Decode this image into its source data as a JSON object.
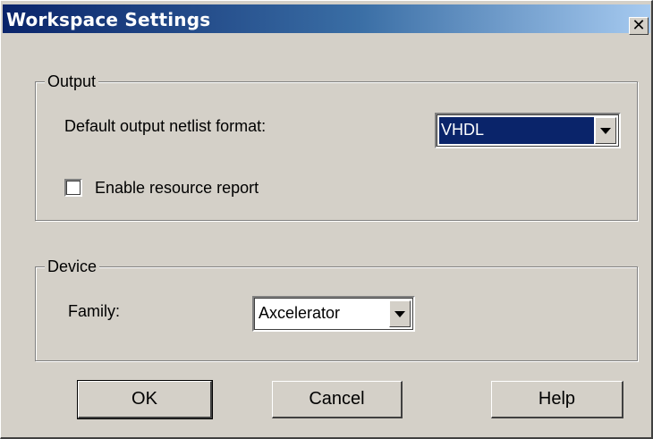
{
  "window": {
    "title": "Workspace Settings",
    "close_glyph": "✕"
  },
  "output_group": {
    "label": "Output",
    "netlist_format_label": "Default output netlist format:",
    "netlist_format_value": "VHDL",
    "resource_report_label": "Enable resource report",
    "resource_report_checked": false
  },
  "device_group": {
    "label": "Device",
    "family_label": "Family:",
    "family_value": "Axcelerator"
  },
  "buttons": {
    "ok": "OK",
    "cancel": "Cancel",
    "help": "Help"
  },
  "colors": {
    "title_active": "#0a246a",
    "face": "#d4d0c8",
    "selection": "#0a246a"
  }
}
